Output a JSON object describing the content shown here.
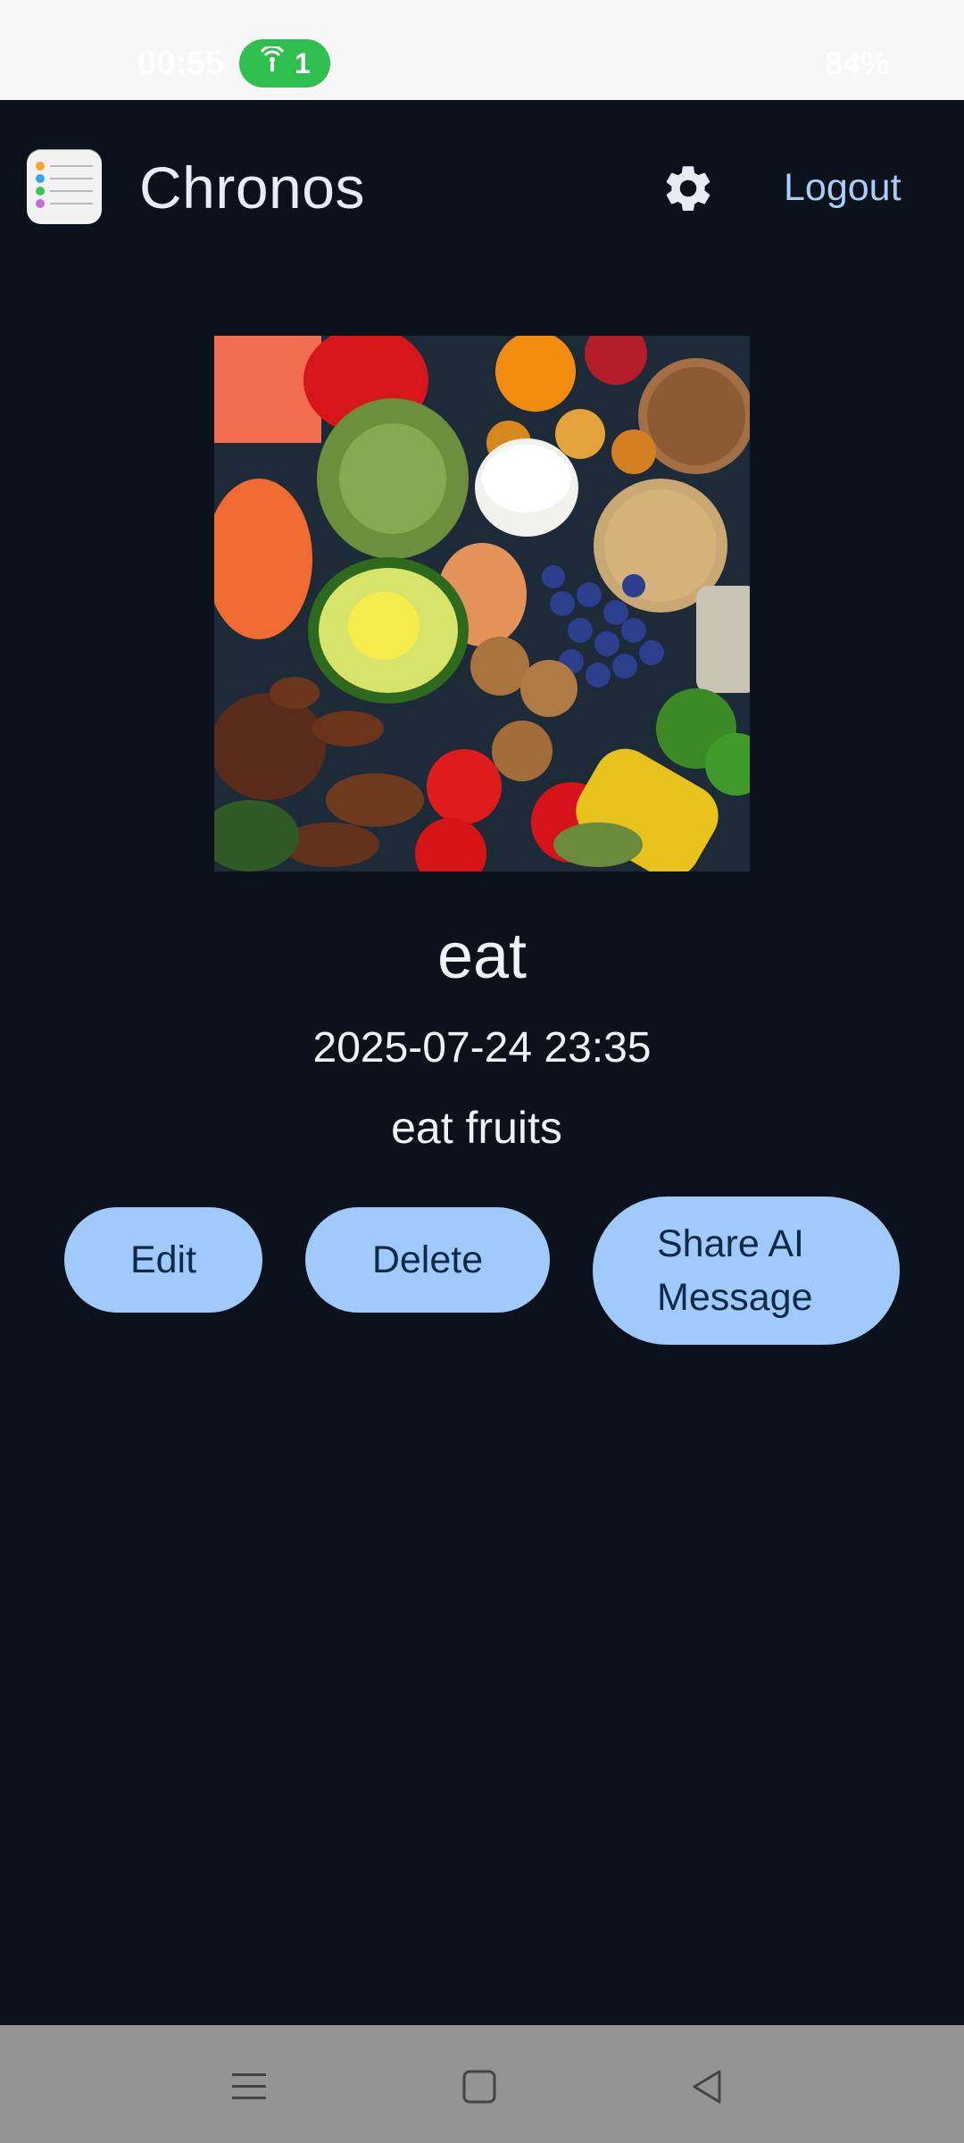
{
  "status_bar": {
    "time": "00:55",
    "hotspot_count": "1",
    "battery": "84%"
  },
  "header": {
    "app_title": "Chronos",
    "settings_icon": "gear-icon",
    "logout_label": "Logout"
  },
  "entry": {
    "image_icon": "food-photo",
    "title": "eat",
    "datetime": "2025-07-24 23:35",
    "description": "eat fruits"
  },
  "actions": {
    "edit_label": "Edit",
    "delete_label": "Delete",
    "share_label_line1": "Share AI",
    "share_label_line2": "Message"
  },
  "nav": {
    "recent_icon": "menu-icon",
    "home_icon": "square-icon",
    "back_icon": "back-triangle-icon"
  },
  "colors": {
    "background": "#0b121c",
    "accent": "#9fcafb",
    "link": "#a8cdf9",
    "status_pill": "#2fbf4f"
  }
}
